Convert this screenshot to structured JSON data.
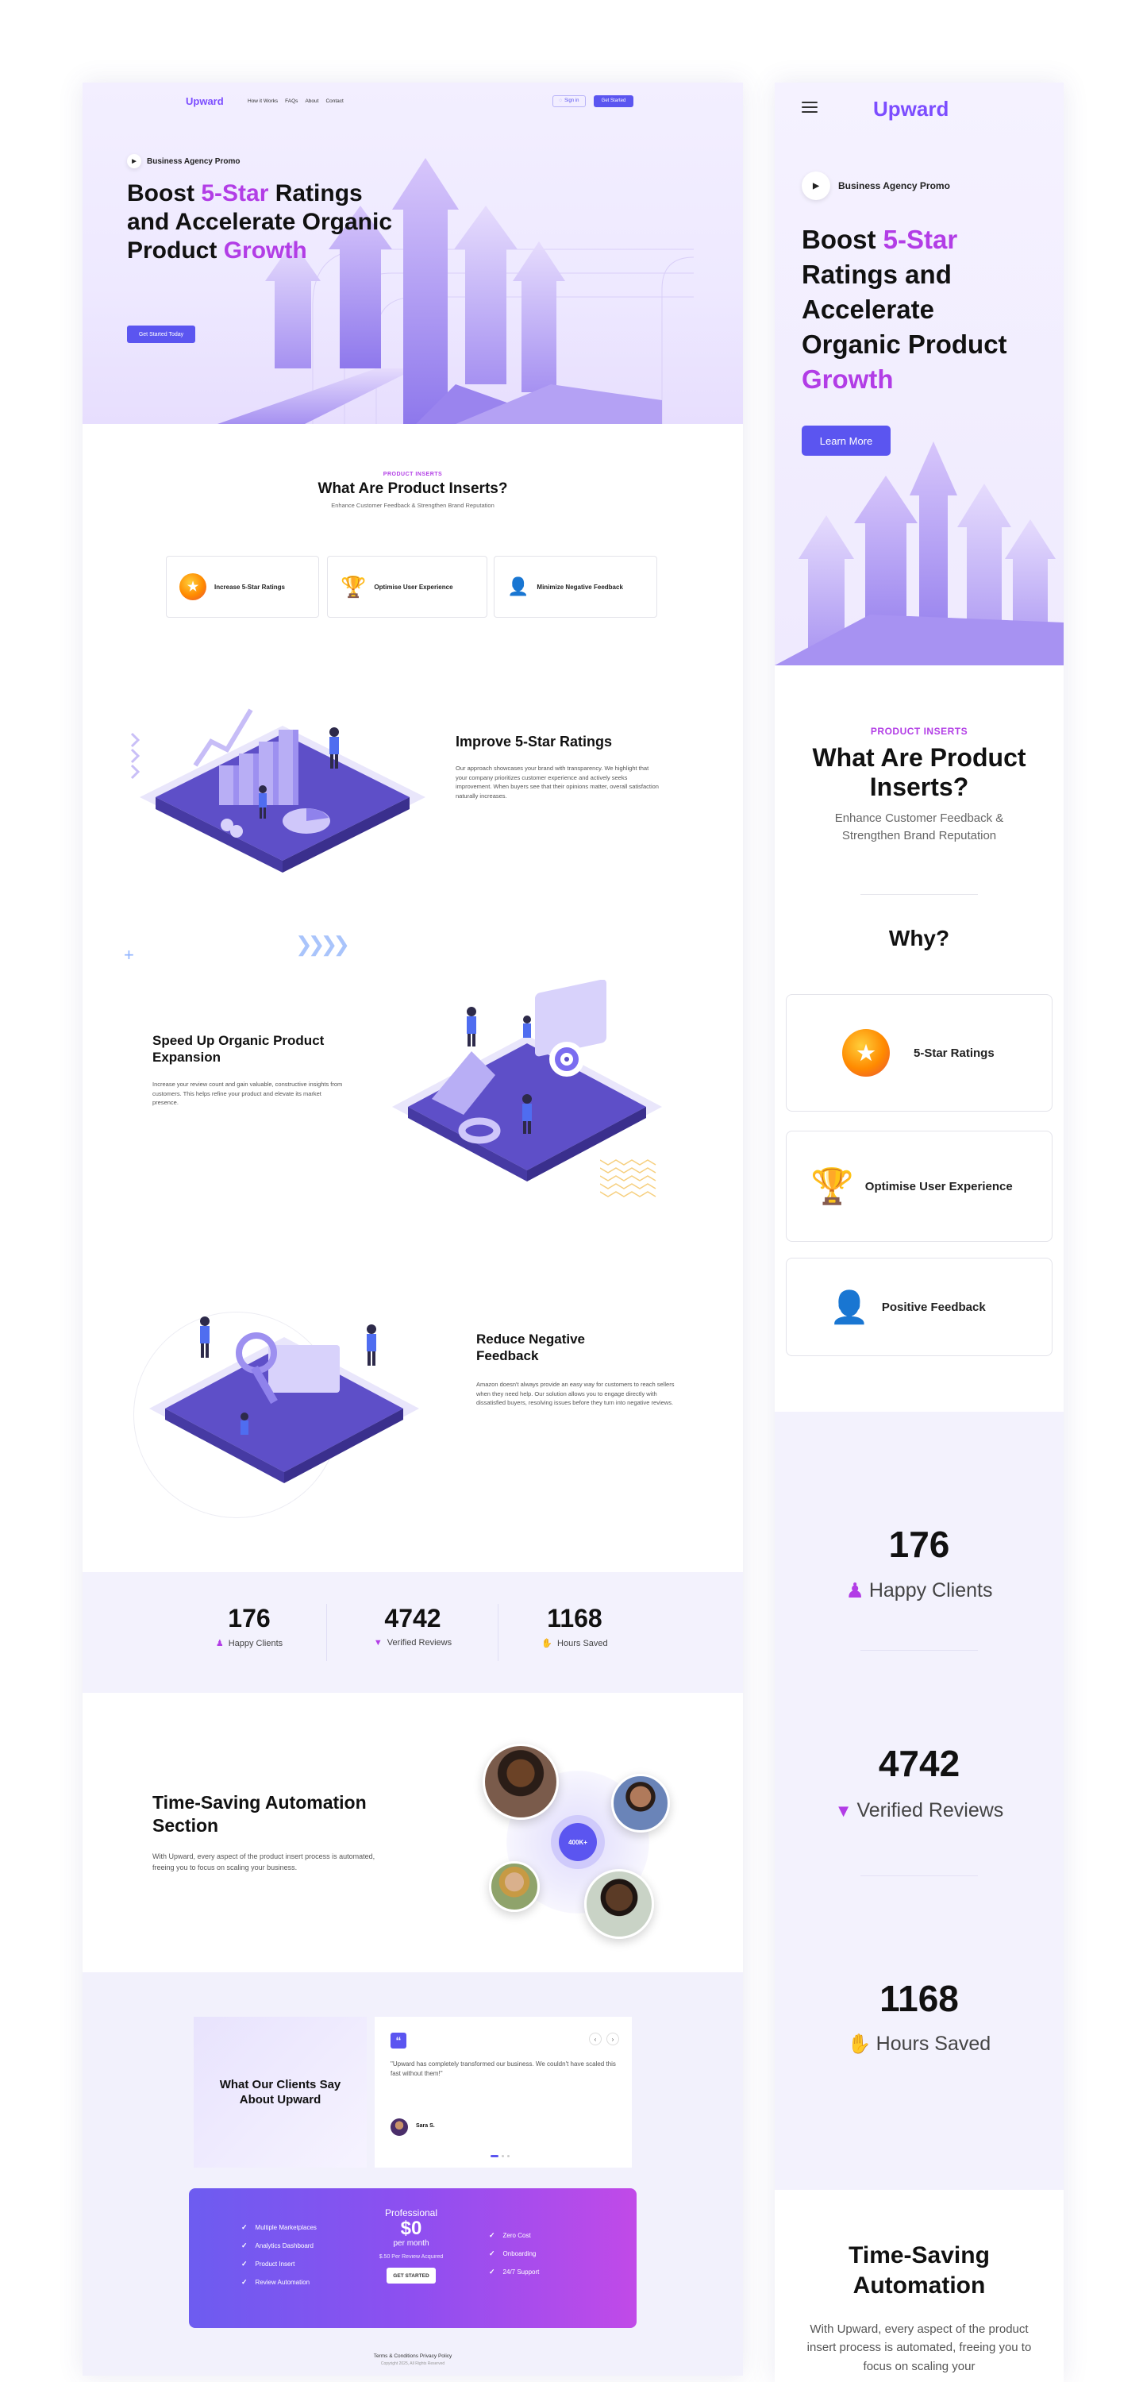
{
  "brand": {
    "name": "Upward",
    "accent": "#b23de6",
    "primary": "#5b55f0"
  },
  "nav": {
    "links": [
      "How it Works",
      "FAQs",
      "About",
      "Contact"
    ],
    "signin_label": "Sign in",
    "cta_label": "Get Started"
  },
  "hero": {
    "badge": "Business Agency Promo",
    "title_pre": "Boost ",
    "title_accent": "5-Star",
    "title_mid": " Ratings and Accelerate Organic Product",
    "title_end": "Growth",
    "cta_label": "Get Started Today",
    "mobile_cta_label": "Learn More"
  },
  "inserts": {
    "eyebrow": "PRODUCT INSERTS",
    "title": "What Are Product Inserts?",
    "subtitle": "Enhance Customer Feedback & Strengthen Brand Reputation",
    "mobile_subtitle": "Enhance Customer Feedback & Strengthen Brand Reputation",
    "mobile_why": "Why?",
    "cards": [
      "Increase 5-Star Ratings",
      "Optimise User Experience",
      "Minimize Negative Feedback"
    ],
    "mobile_cards": [
      "5-Star Ratings",
      "Optimise User Experience",
      "Positive Feedback"
    ]
  },
  "features": [
    {
      "title": "Improve 5-Star Ratings",
      "body": "Our approach showcases your brand with transparency. We highlight that your company prioritizes customer experience and actively seeks improvement. When buyers see that their opinions matter, overall satisfaction naturally increases."
    },
    {
      "title": "Speed Up Organic Product Expansion",
      "body": "Increase your review count and gain valuable, constructive insights from customers. This helps refine your product and elevate its market presence."
    },
    {
      "title": "Reduce Negative Feedback",
      "body": "Amazon doesn't always provide an easy way for customers to reach sellers when they need help. Our solution allows you to engage directly with dissatisfied buyers, resolving issues before they turn into negative reviews."
    }
  ],
  "stats": [
    {
      "number": "176",
      "label": "Happy Clients",
      "icon": "person-icon"
    },
    {
      "number": "4742",
      "label": "Verified Reviews",
      "icon": "trophy-icon"
    },
    {
      "number": "1168",
      "label": "Hours Saved",
      "icon": "hand-coin-icon"
    }
  ],
  "automation": {
    "title": "Time-Saving Automation Section",
    "mobile_title": "Time-Saving Automation",
    "body": "With Upward, every aspect of the product insert process is automated, freeing you to focus on scaling your business.",
    "mobile_body": "With Upward, every aspect of the product insert process is automated, freeing you to focus on scaling your",
    "badge": "400K+"
  },
  "testimonials": {
    "title": "What Our Clients Say About Upward",
    "quote": "\"Upward has completely transformed our business. We couldn't have scaled this fast without them!\"",
    "author": "Sara S."
  },
  "pricing": {
    "plan": "Professional",
    "price": "$0",
    "period": "per month",
    "note": "$.50 Per Review Acquired",
    "cta": "GET STARTED",
    "left_features": [
      "Multiple Marketplaces",
      "Analytics Dashboard",
      "Product Insert",
      "Review Automation"
    ],
    "right_features": [
      "Zero Cost",
      "Onboarding",
      "24/7 Support"
    ]
  },
  "footer": {
    "links": "Terms & Conditions   Privacy Policy",
    "copyright": "Copyright 2025, All Rights Reserved"
  }
}
